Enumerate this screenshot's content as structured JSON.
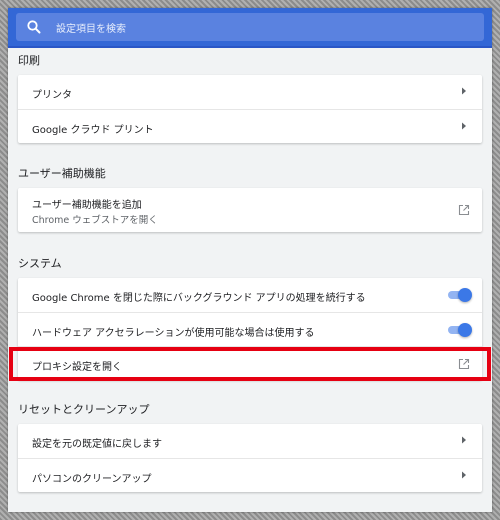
{
  "search": {
    "placeholder": "設定項目を検索"
  },
  "sections": {
    "print": {
      "title": "印刷",
      "items": [
        {
          "label": "プリンタ"
        },
        {
          "label": "Google クラウド プリント"
        }
      ]
    },
    "accessibility": {
      "title": "ユーザー補助機能",
      "items": [
        {
          "label": "ユーザー補助機能を追加",
          "sublabel": "Chrome ウェブストアを開く"
        }
      ]
    },
    "system": {
      "title": "システム",
      "items": [
        {
          "label": "Google Chrome を閉じた際にバックグラウンド アプリの処理を続行する",
          "toggle_on": true
        },
        {
          "label": "ハードウェア アクセラレーションが使用可能な場合は使用する",
          "toggle_on": true
        },
        {
          "label": "プロキシ設定を開く"
        }
      ]
    },
    "reset": {
      "title": "リセットとクリーンアップ",
      "items": [
        {
          "label": "設定を元の既定値に戻します"
        },
        {
          "label": "パソコンのクリーンアップ"
        }
      ]
    }
  },
  "colors": {
    "header": "#3367d6",
    "toggle_on": "#3b78e7",
    "highlight": "#e60012"
  }
}
